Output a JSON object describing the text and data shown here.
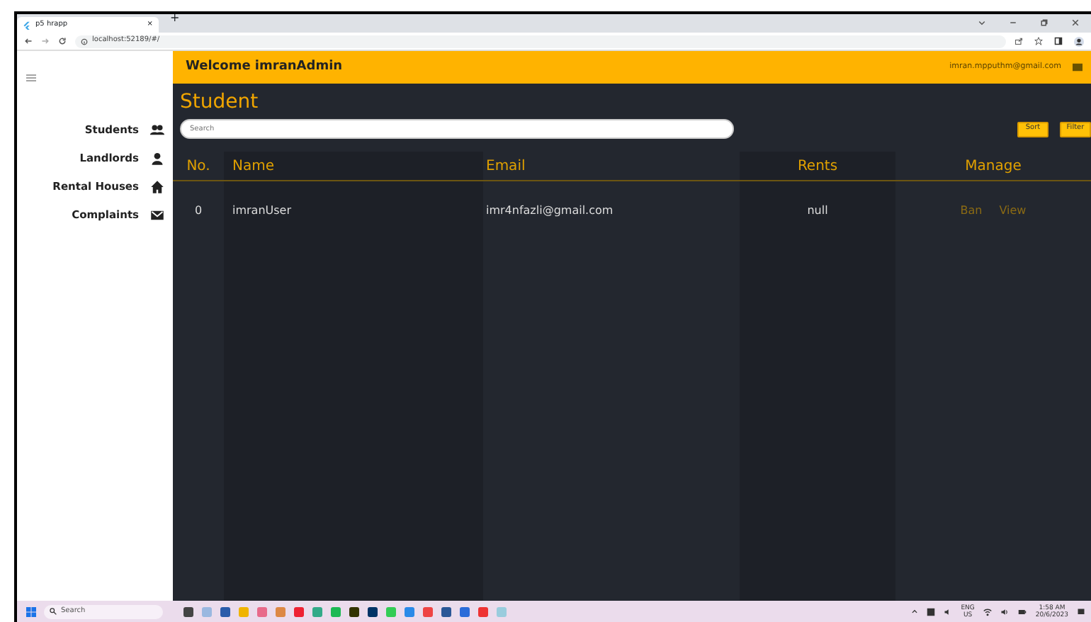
{
  "browser": {
    "tab_title": "p5 hrapp",
    "new_tab": "+",
    "tab_close": "×",
    "url": "localhost:52189/#/"
  },
  "header": {
    "title": "Welcome imranAdmin",
    "email": "imran.mpputhm@gmail.com"
  },
  "sidebar": {
    "items": [
      {
        "label": "Students",
        "kind": "students"
      },
      {
        "label": "Landlords",
        "kind": "landlords"
      },
      {
        "label": "Rental Houses",
        "kind": "houses"
      },
      {
        "label": "Complaints",
        "kind": "complaints"
      }
    ]
  },
  "page_title": "Student",
  "search": {
    "placeholder": "Search"
  },
  "buttons": [
    "Sort",
    "Filter"
  ],
  "table": {
    "columns": [
      "No.",
      "Name",
      "Email",
      "Rents",
      "Manage"
    ],
    "rows": [
      {
        "no": "0",
        "name": "imranUser",
        "email": "imr4nfazli@gmail.com",
        "rents": "null",
        "actions": [
          "Ban",
          "View"
        ]
      }
    ]
  },
  "taskbar": {
    "search_placeholder": "Search",
    "language": "ENG",
    "region": "US",
    "time": "1:58 AM",
    "date": "20/6/2023"
  }
}
